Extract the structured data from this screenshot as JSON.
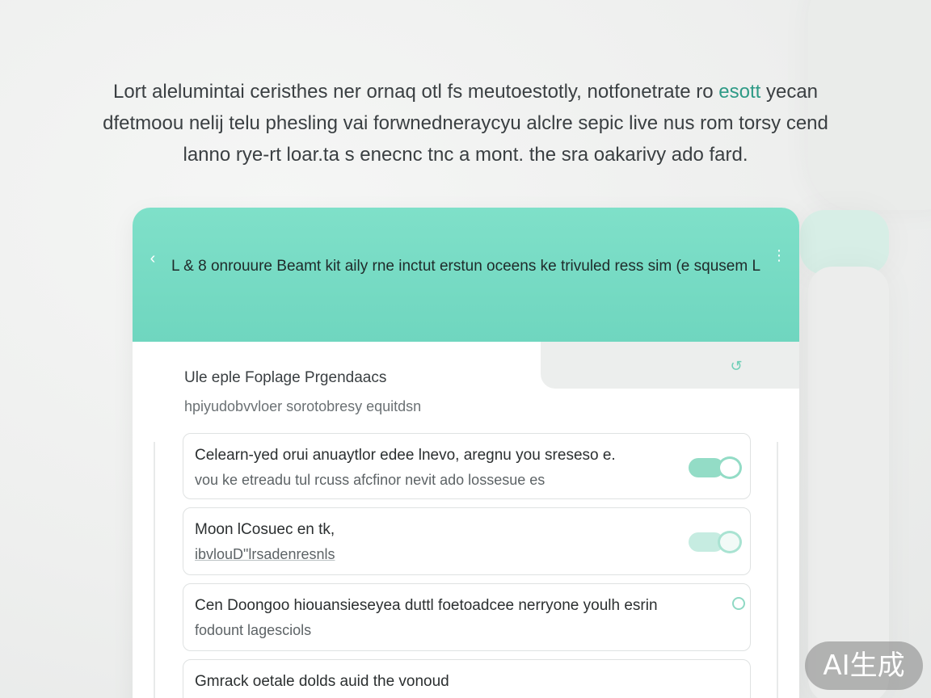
{
  "intro": {
    "line1_a": "Lort alelumintai ceristhes ner ornaq otl fs meutoestotly, notfonetrate ro ",
    "line1_accent": "esott",
    "line1_b": " yecan",
    "line2": "dfetmoou nelij telu phesling vai forwnedneraycyu alclre sepic live nus rom torsy cend",
    "line3": "lanno rye-rt loar.ta s enecnc tnc a mont. the sra oakarivy ado fard."
  },
  "header": {
    "back_icon": "arrow-left-icon",
    "title": "L & 8 onrouure Beamt kit aily rne inctut erstun oceens ke trivuled ress sim (e squsem L",
    "menu_icon": "more-vertical-icon"
  },
  "section": {
    "title": "Ule eple Foplage Prgendaacs",
    "subtitle": "hpiyudobvvloer sorotobresy equitdsn",
    "tab_icon": "refresh-icon"
  },
  "items": [
    {
      "line1": "Celearn-yed orui anuaytlor edee lnevo, aregnu you sreseso e.",
      "line2": "vou ke etreadu tul rcuss afcfinor nevit ado lossesue es",
      "control": "toggle"
    },
    {
      "line1": "Moon lCosuec en tk,",
      "line2": "ibvlouD\"lrsadenresnls",
      "control": "toggle"
    },
    {
      "line1": "Cen Doongoo hiouansieseyea duttl foetoadcee nerryone youlh esrin",
      "line2": "fodount lagesciols",
      "control": "radio"
    },
    {
      "line1": "Gmrack oetale dolds auid the vonoud",
      "line2": "",
      "control": "none"
    }
  ],
  "watermark": "AI生成",
  "colors": {
    "accent": "#7fe0c9",
    "accent_dark": "#2e9a86",
    "toggle": "#93dcc6"
  }
}
